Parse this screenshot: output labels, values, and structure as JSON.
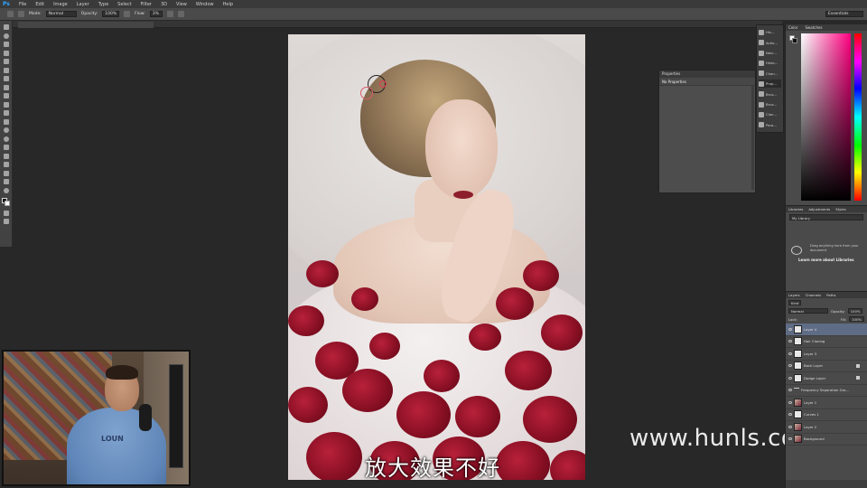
{
  "menubar": {
    "logo": "Ps",
    "items": [
      "File",
      "Edit",
      "Image",
      "Layer",
      "Type",
      "Select",
      "Filter",
      "3D",
      "View",
      "Window",
      "Help"
    ]
  },
  "optionsbar": {
    "mode_label": "Mode:",
    "mode_value": "Normal",
    "opacity_label": "Opacity:",
    "opacity_value": "100%",
    "flow_label": "Flow:",
    "flow_value": "3%",
    "workspace": "Essentials"
  },
  "properties": {
    "title": "Properties",
    "subtitle": "No Properties"
  },
  "iconstrip": {
    "items": [
      "His...",
      "Actio...",
      "Navi...",
      "Histo...",
      "Chan...",
      "Prop...",
      "Brus...",
      "Brus...",
      "Clon...",
      "Para..."
    ]
  },
  "color_panel": {
    "tabs": [
      "Color",
      "Swatches"
    ]
  },
  "libraries": {
    "tabs": [
      "Libraries",
      "Adjustments",
      "Styles"
    ],
    "library_name": "My Library",
    "message": "Drag anything here from your document",
    "link": "Learn more about Libraries"
  },
  "layers": {
    "tabs": [
      "Layers",
      "Channels",
      "Paths"
    ],
    "filter_kind": "Kind",
    "blend_mode": "Normal",
    "opacity_label": "Opacity:",
    "opacity_value": "100%",
    "lock_label": "Lock:",
    "fill_label": "Fill:",
    "fill_value": "100%",
    "rows": [
      {
        "name": "Layer 4",
        "selected": true,
        "thumb": "white"
      },
      {
        "name": "Hair Cloning",
        "selected": false,
        "thumb": "white"
      },
      {
        "name": "Layer 3",
        "selected": false,
        "thumb": "white"
      },
      {
        "name": "Back Layer",
        "selected": false,
        "thumb": "white"
      },
      {
        "name": "Dodge Layer",
        "selected": false,
        "thumb": "white"
      },
      {
        "name": "Frequency Separation Gro...",
        "selected": false,
        "thumb": "folder"
      },
      {
        "name": "Layer 1",
        "selected": false,
        "thumb": "photo"
      },
      {
        "name": "Curves 1",
        "selected": false,
        "thumb": "white"
      },
      {
        "name": "Layer 2",
        "selected": false,
        "thumb": "photo"
      },
      {
        "name": "Background",
        "selected": false,
        "thumb": "photo"
      }
    ]
  },
  "webcam": {
    "shirt_text": "LOUN"
  },
  "subtitle": "放大效果不好",
  "watermark": "www.hunls.com",
  "colors": {
    "accent": "#31a8ff",
    "rose": "#8a1024",
    "layer_selected": "#5f6c85"
  }
}
